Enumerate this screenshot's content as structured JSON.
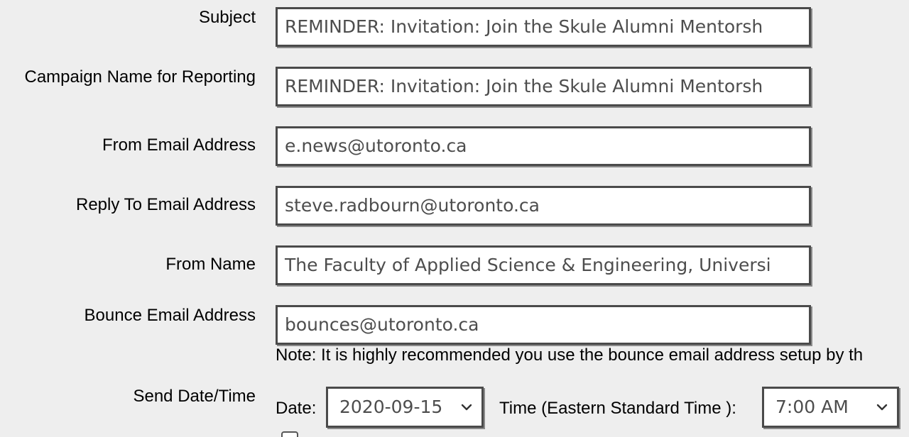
{
  "form": {
    "subject": {
      "label": "Subject",
      "value": "REMINDER: Invitation: Join the Skule Alumni Mentorsh"
    },
    "campaign_name": {
      "label": "Campaign Name for Reporting",
      "value": "REMINDER: Invitation: Join the Skule Alumni Mentorsh"
    },
    "from_email": {
      "label": "From Email Address",
      "value": "e.news@utoronto.ca"
    },
    "reply_to": {
      "label": "Reply To Email Address",
      "value": "steve.radbourn@utoronto.ca"
    },
    "from_name": {
      "label": "From Name",
      "value": "The Faculty of Applied Science & Engineering, Universi"
    },
    "bounce_email": {
      "label": "Bounce Email Address",
      "value": "bounces@utoronto.ca",
      "note": "Note: It is highly recommended you use the bounce email address setup by th"
    },
    "send_datetime": {
      "label": "Send Date/Time",
      "date_label": "Date:",
      "date_value": "2020-09-15",
      "time_label": "Time (Eastern Standard Time ):",
      "time_value": "7:00 AM"
    }
  },
  "icons": {
    "date_dropdown": "chevron-down-icon",
    "time_dropdown": "chevron-down-icon"
  }
}
